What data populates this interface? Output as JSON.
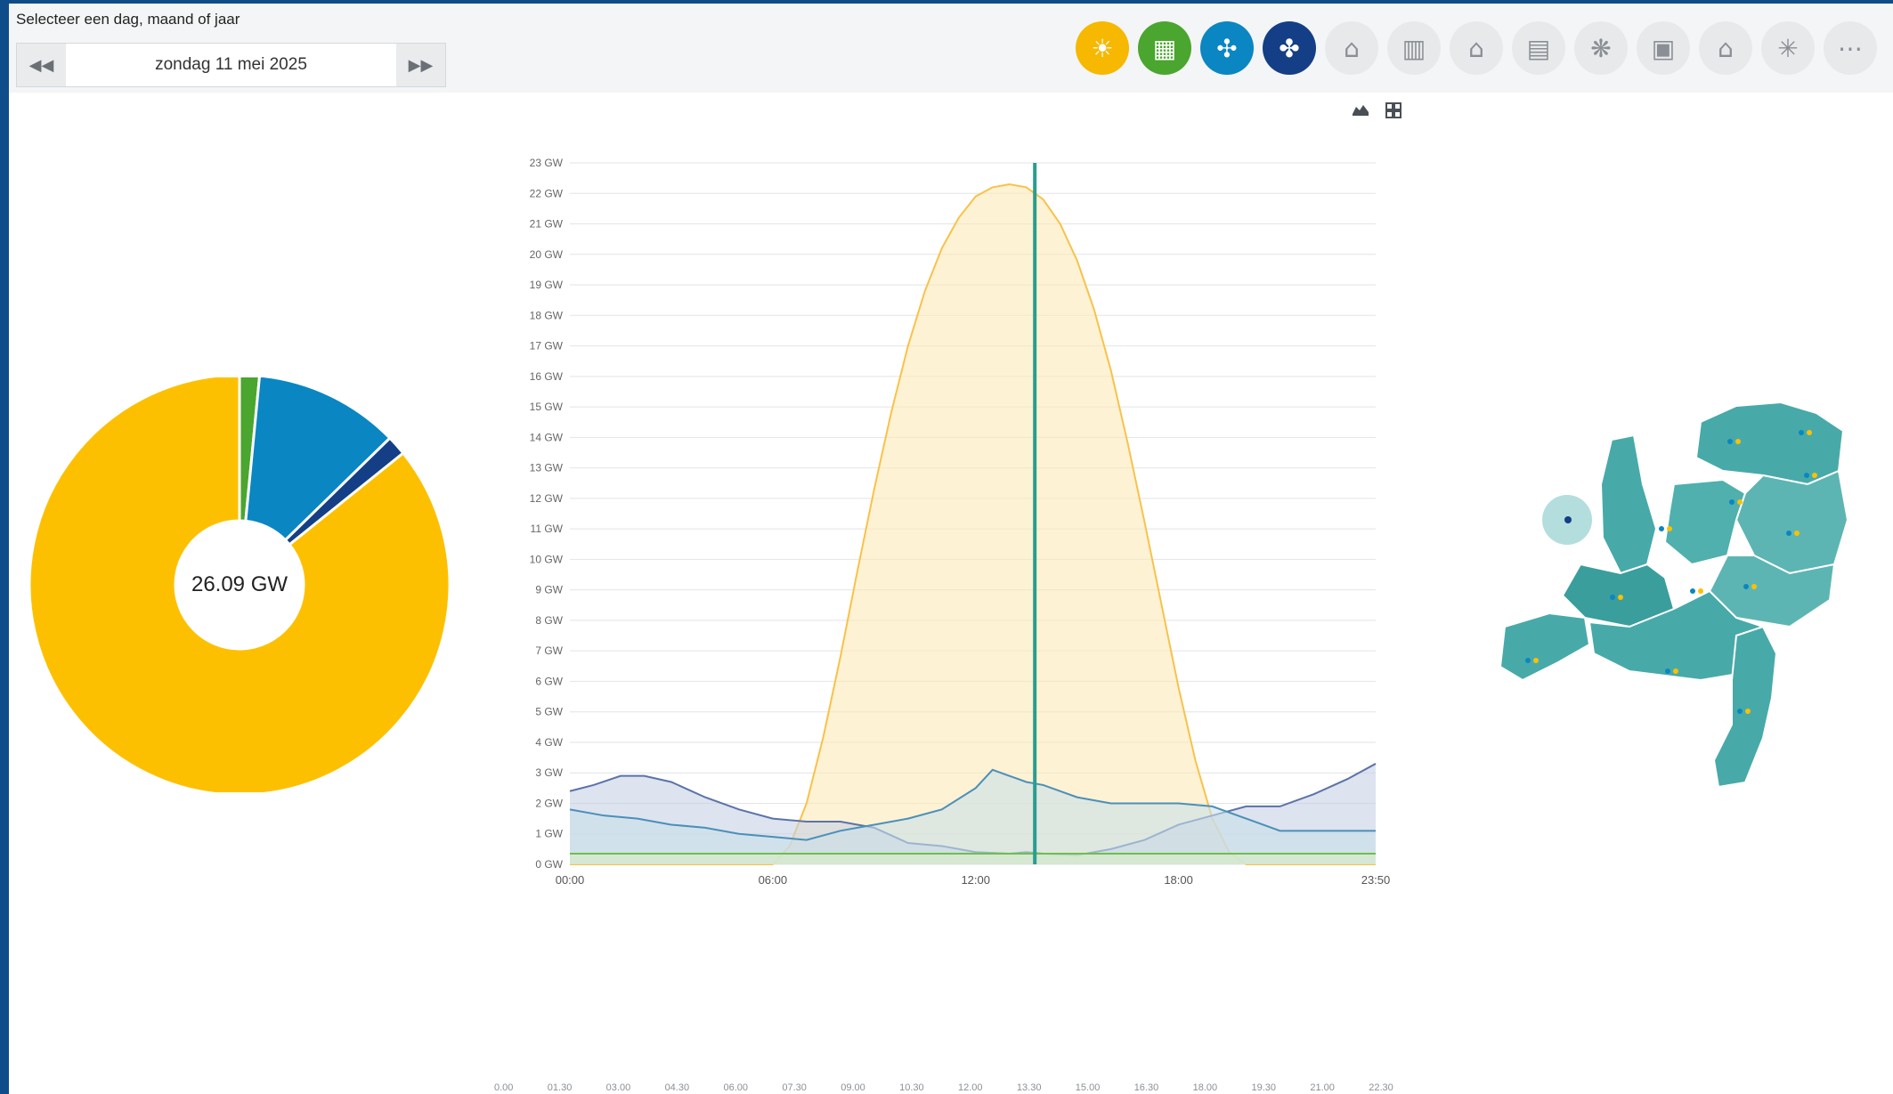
{
  "header": {
    "select_label": "Selecteer een dag, maand of jaar",
    "date": "zondag 11 mei 2025",
    "prev_label": "◀◀",
    "next_label": "▶▶"
  },
  "filters": [
    {
      "icon": "sun-icon",
      "color": "#f6b800",
      "active": true
    },
    {
      "icon": "solar-panel-icon",
      "color": "#4aa62e",
      "active": true
    },
    {
      "icon": "wind-turbine-icon",
      "color": "#0a86c2",
      "active": true
    },
    {
      "icon": "offshore-wind-icon",
      "color": "#143f86",
      "active": true
    },
    {
      "icon": "house-icon",
      "color": "#e8e9eb",
      "active": false
    },
    {
      "icon": "factory-icon",
      "color": "#e8e9eb",
      "active": false
    },
    {
      "icon": "house-fire-icon",
      "color": "#e8e9eb",
      "active": false
    },
    {
      "icon": "industry-icon",
      "color": "#e8e9eb",
      "active": false
    },
    {
      "icon": "biomass-icon",
      "color": "#e8e9eb",
      "active": false
    },
    {
      "icon": "fuel-pump-icon",
      "color": "#e8e9eb",
      "active": false
    },
    {
      "icon": "home-energy-icon",
      "color": "#e8e9eb",
      "active": false
    },
    {
      "icon": "smart-meter-icon",
      "color": "#e8e9eb",
      "active": false
    },
    {
      "icon": "more-icon",
      "color": "#e8e9eb",
      "active": false
    }
  ],
  "total_label": "26.09 GW",
  "pie": {
    "segments": [
      {
        "name": "sun-share",
        "value": 0.845,
        "color": "#fdc000"
      },
      {
        "name": "solar-park-share",
        "value": 0.015,
        "color": "#4aa62e"
      },
      {
        "name": "onshore-wind-share",
        "value": 0.11,
        "color": "#0a86c2"
      },
      {
        "name": "offshore-wind-share",
        "value": 0.015,
        "color": "#143f86"
      }
    ]
  },
  "chart_data": {
    "type": "area",
    "y_ticks": [
      "0 GW",
      "1 GW",
      "2 GW",
      "3 GW",
      "4 GW",
      "5 GW",
      "6 GW",
      "7 GW",
      "8 GW",
      "9 GW",
      "10 GW",
      "11 GW",
      "12 GW",
      "13 GW",
      "14 GW",
      "15 GW",
      "16 GW",
      "17 GW",
      "18 GW",
      "19 GW",
      "20 GW",
      "21 GW",
      "22 GW",
      "23 GW"
    ],
    "x_ticks": [
      "00:00",
      "06:00",
      "12:00",
      "18:00",
      "23:50"
    ],
    "x_hours": [
      0,
      6,
      12,
      18,
      23.83
    ],
    "ylim": [
      0,
      23
    ],
    "xlim": [
      0,
      23.83
    ],
    "cursor_hour": 13.75,
    "series": [
      {
        "color": "#f8c24a",
        "fill": "#fde9b8",
        "x": [
          0,
          6,
          6.5,
          7,
          7.5,
          8,
          8.5,
          9,
          9.5,
          10,
          10.5,
          11,
          11.5,
          12,
          12.5,
          13,
          13.5,
          14,
          14.5,
          15,
          15.5,
          16,
          16.5,
          17,
          17.5,
          18,
          18.5,
          19,
          19.5,
          20,
          20.5,
          21,
          23.83
        ],
        "y": [
          0,
          0,
          0.6,
          2,
          4.2,
          6.8,
          9.6,
          12.3,
          14.8,
          17,
          18.8,
          20.2,
          21.2,
          21.9,
          22.2,
          22.3,
          22.2,
          21.8,
          21,
          19.8,
          18.2,
          16.2,
          13.8,
          11.2,
          8.5,
          5.8,
          3.4,
          1.5,
          0.4,
          0,
          0,
          0,
          0
        ]
      },
      {
        "color": "#5b73a8",
        "fill": "#c7d0e4",
        "x": [
          0,
          0.7,
          1.5,
          2.2,
          3,
          4,
          5,
          6,
          7,
          8,
          9,
          10,
          11,
          12,
          13,
          13.5,
          14,
          15,
          16,
          17,
          18,
          19,
          20,
          21,
          22,
          23,
          23.83
        ],
        "y": [
          2.4,
          2.6,
          2.9,
          2.9,
          2.7,
          2.2,
          1.8,
          1.5,
          1.4,
          1.4,
          1.2,
          0.7,
          0.6,
          0.4,
          0.35,
          0.4,
          0.35,
          0.3,
          0.5,
          0.8,
          1.3,
          1.6,
          1.9,
          1.9,
          2.3,
          2.8,
          3.3
        ]
      },
      {
        "color": "#4a90b8",
        "fill": "#c9dfea",
        "x": [
          0,
          1,
          2,
          3,
          4,
          5,
          6,
          7,
          8,
          9,
          10,
          11,
          12,
          12.5,
          13,
          13.5,
          14,
          15,
          16,
          17,
          18,
          19,
          20,
          21,
          22,
          23,
          23.83
        ],
        "y": [
          1.8,
          1.6,
          1.5,
          1.3,
          1.2,
          1.0,
          0.9,
          0.8,
          1.1,
          1.3,
          1.5,
          1.8,
          2.5,
          3.1,
          2.9,
          2.7,
          2.6,
          2.2,
          2.0,
          2.0,
          2.0,
          1.9,
          1.5,
          1.1,
          1.1,
          1.1,
          1.1
        ]
      },
      {
        "color": "#6cc04a",
        "fill": "#d9ecc4",
        "x": [
          0,
          23.83
        ],
        "y": [
          0.35,
          0.35
        ]
      }
    ]
  },
  "time_ticks": [
    "0.00",
    "01.30",
    "03.00",
    "04.30",
    "06.00",
    "07.30",
    "09.00",
    "10.30",
    "12.00",
    "13.30",
    "15.00",
    "16.30",
    "18.00",
    "19.30",
    "21.00",
    "22.30"
  ],
  "map": {
    "color": "#47aaa9",
    "light": "#7fc4c2"
  }
}
